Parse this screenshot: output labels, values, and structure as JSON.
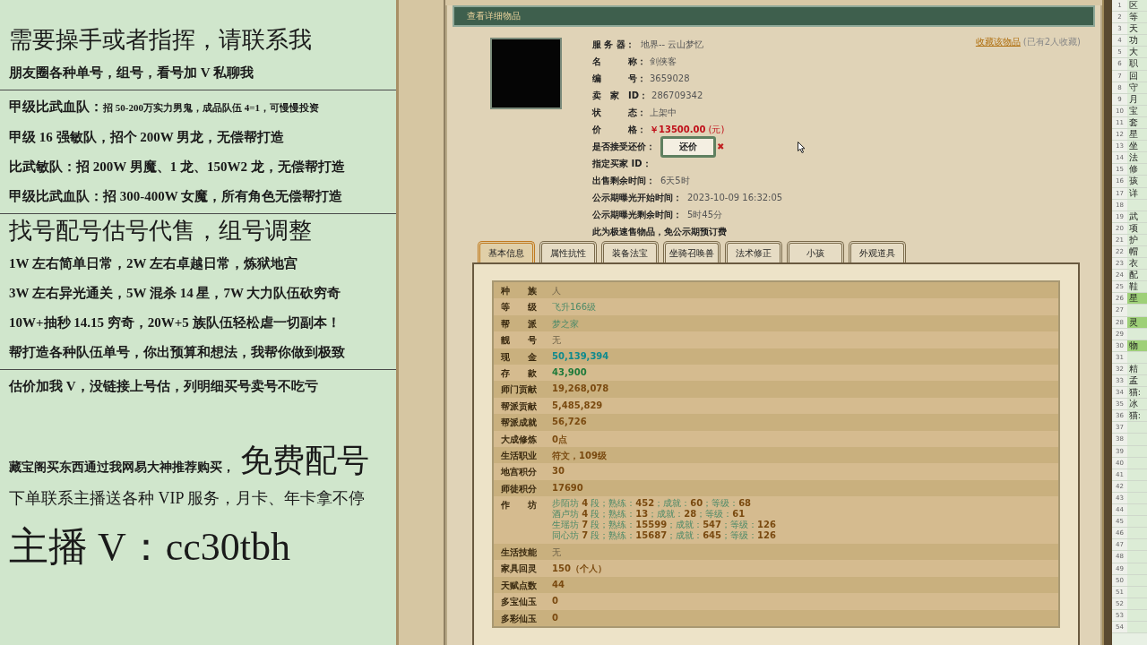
{
  "promo_panel": {
    "items": [
      {
        "kind": "heading",
        "text": "需要操手或者指挥，请联系我"
      },
      {
        "kind": "text",
        "text": "朋友圈各种单号，组号，看号加 V 私聊我"
      },
      {
        "kind": "rule"
      },
      {
        "kind": "split",
        "lead": "甲级比武血队：",
        "rest": "招 50-200万实力男鬼，成品队伍 4=1，可慢慢投资"
      },
      {
        "kind": "text",
        "text": "甲级 16 强敏队，招个 200W 男龙，无偿帮打造"
      },
      {
        "kind": "text",
        "text": "比武敏队：招 200W 男魔、1 龙、150W2 龙，无偿帮打造"
      },
      {
        "kind": "text",
        "text": "甲级比武血队：招 300-400W 女魔，所有角色无偿帮打造"
      },
      {
        "kind": "rule"
      },
      {
        "kind": "heading",
        "text": "找号配号估号代售，组号调整"
      },
      {
        "kind": "text",
        "text": "1W 左右简单日常，2W 左右卓越日常，炼狱地宫"
      },
      {
        "kind": "text",
        "text": "3W 左右异光通关，5W 混杀 14 星，7W 大力队伍砍穷奇"
      },
      {
        "kind": "text",
        "text": "10W+抽秒 14.15 穷奇，20W+5 族队伍轻松虐一切副本！"
      },
      {
        "kind": "text",
        "text": "帮打造各种队伍单号，你出预算和想法，我帮你做到极致"
      },
      {
        "kind": "rule"
      },
      {
        "kind": "text",
        "text": "估价加我 V，没链接上号估，列明细买号卖号不吃亏"
      },
      {
        "kind": "pair",
        "lead": "藏宝阁买东西通过我网易大神推荐购买，",
        "rest": "免费配号"
      },
      {
        "kind": "wide",
        "text": "下单联系主播送各种 VIP 服务，月卡、年卡拿不停"
      },
      {
        "kind": "contact",
        "text": "主播 V：cc30tbh"
      }
    ]
  },
  "detail_window": {
    "title": "查看详细物品",
    "favorite": {
      "link": "收藏该物品",
      "note": "(已有2人收藏)"
    },
    "info": [
      {
        "kind": "field",
        "label": "服 务 器：",
        "value": "地界-- 云山梦忆"
      },
      {
        "kind": "field",
        "label": "名　　　称：",
        "value": "剑侠客"
      },
      {
        "kind": "field",
        "label": "编　　　号：",
        "value": "3659028"
      },
      {
        "kind": "field",
        "label": "卖　家　ID：",
        "value": "286709342"
      },
      {
        "kind": "field",
        "label": "状　　　态：",
        "value": "上架中"
      },
      {
        "kind": "price",
        "label": "价　　　格：",
        "value": "￥13500.00",
        "unit": "(元)"
      },
      {
        "kind": "button",
        "label": "是否接受还价：",
        "value": "还价",
        "mark": "✖"
      },
      {
        "kind": "wide",
        "label": "指定买家 ID："
      },
      {
        "kind": "wide",
        "label": "出售剩余时间：",
        "value": "6天5时"
      },
      {
        "kind": "wide",
        "label": "公示期曝光开始时间：",
        "value": "2023-10-09 16:32:05"
      },
      {
        "kind": "wide",
        "label": "公示期曝光剩余时间：",
        "value": "5时45分"
      },
      {
        "kind": "note",
        "label": "此为极速售物品，免公示期预订费"
      }
    ],
    "tabs": [
      {
        "label": "基本信息",
        "selected": true
      },
      {
        "label": "属性抗性",
        "selected": false
      },
      {
        "label": "装备法宝",
        "selected": false
      },
      {
        "label": "坐骑召唤兽",
        "selected": false
      },
      {
        "label": "法术修正",
        "selected": false
      },
      {
        "label": "小孩",
        "selected": false
      },
      {
        "label": "外观道具",
        "selected": false
      }
    ],
    "table": {
      "rows": [
        {
          "label": "种　　族",
          "value": "人",
          "kind": "plain"
        },
        {
          "label": "等　　级",
          "value": "飞升166级",
          "kind": "green"
        },
        {
          "label": "帮　　派",
          "value": "梦之家",
          "kind": "green"
        },
        {
          "label": "靓　　号",
          "value": "无",
          "kind": "plain"
        },
        {
          "label": "现　　金",
          "value": "50,139,394",
          "kind": "cyan"
        },
        {
          "label": "存　　款",
          "value": "43,900",
          "kind": "lime"
        },
        {
          "label": "师门贡献",
          "value": "19,268,078",
          "kind": "number"
        },
        {
          "label": "帮派贡献",
          "value": "5,485,829",
          "kind": "number"
        },
        {
          "label": "帮派成就",
          "value": "56,726",
          "kind": "number"
        },
        {
          "label": "大成修炼",
          "value": "0点",
          "kind": "number"
        },
        {
          "label": "生活职业",
          "value": "符文，109级",
          "kind": "number"
        },
        {
          "label": "地宫积分",
          "value": "30",
          "kind": "number"
        },
        {
          "label": "师徒积分",
          "value": "17690",
          "kind": "number"
        },
        {
          "label": "作　　坊",
          "kind": "workshop",
          "lines": [
            [
              {
                "text": "步陌坊 ",
                "kind": "label"
              },
              {
                "text": "4",
                "kind": "number"
              },
              {
                "text": " 段；熟练：",
                "kind": "label"
              },
              {
                "text": "452",
                "kind": "number"
              },
              {
                "text": "；成就：",
                "kind": "label"
              },
              {
                "text": "60",
                "kind": "number"
              },
              {
                "text": "；等级：",
                "kind": "label"
              },
              {
                "text": "68",
                "kind": "number"
              }
            ],
            [
              {
                "text": "酒卢坊 ",
                "kind": "label"
              },
              {
                "text": "4",
                "kind": "number"
              },
              {
                "text": " 段；熟练：",
                "kind": "label"
              },
              {
                "text": "13",
                "kind": "number"
              },
              {
                "text": "；成就：",
                "kind": "label"
              },
              {
                "text": "28",
                "kind": "number"
              },
              {
                "text": "；等级：",
                "kind": "label"
              },
              {
                "text": "61",
                "kind": "number"
              }
            ],
            [
              {
                "text": "生瑶坊 ",
                "kind": "label"
              },
              {
                "text": "7",
                "kind": "number"
              },
              {
                "text": " 段；熟练：",
                "kind": "label"
              },
              {
                "text": "15599",
                "kind": "number"
              },
              {
                "text": "；成就：",
                "kind": "label"
              },
              {
                "text": "547",
                "kind": "number"
              },
              {
                "text": "；等级：",
                "kind": "label"
              },
              {
                "text": "126",
                "kind": "number"
              }
            ],
            [
              {
                "text": "同心坊 ",
                "kind": "label"
              },
              {
                "text": "7",
                "kind": "number"
              },
              {
                "text": " 段；熟练：",
                "kind": "label"
              },
              {
                "text": "15687",
                "kind": "number"
              },
              {
                "text": "；成就：",
                "kind": "label"
              },
              {
                "text": "645",
                "kind": "number"
              },
              {
                "text": "；等级：",
                "kind": "label"
              },
              {
                "text": "126",
                "kind": "number"
              }
            ]
          ]
        },
        {
          "label": "生活技能",
          "value": "无",
          "kind": "plain"
        },
        {
          "label": "家具回灵",
          "value": "150（个人）",
          "kind": "number"
        },
        {
          "label": "天赋点数",
          "value": "44",
          "kind": "number"
        },
        {
          "label": "多宝仙玉",
          "value": "0",
          "kind": "number"
        },
        {
          "label": "多彩仙玉",
          "value": "0",
          "kind": "number"
        }
      ]
    }
  },
  "spreadsheet": {
    "rows": [
      {
        "number": "1",
        "text": "区",
        "highlighted": false
      },
      {
        "number": "2",
        "text": "等",
        "highlighted": false
      },
      {
        "number": "3",
        "text": "天",
        "highlighted": false
      },
      {
        "number": "4",
        "text": "功",
        "highlighted": false
      },
      {
        "number": "5",
        "text": "大",
        "highlighted": false
      },
      {
        "number": "6",
        "text": "职",
        "highlighted": false
      },
      {
        "number": "7",
        "text": "回",
        "highlighted": false
      },
      {
        "number": "8",
        "text": "守",
        "highlighted": false
      },
      {
        "number": "9",
        "text": "月",
        "highlighted": false
      },
      {
        "number": "10",
        "text": "宝",
        "highlighted": false
      },
      {
        "number": "11",
        "text": "套",
        "highlighted": false
      },
      {
        "number": "12",
        "text": "星",
        "highlighted": false
      },
      {
        "number": "13",
        "text": "坐",
        "highlighted": false
      },
      {
        "number": "14",
        "text": "法",
        "highlighted": false
      },
      {
        "number": "15",
        "text": "修",
        "highlighted": false
      },
      {
        "number": "16",
        "text": "孩",
        "highlighted": false
      },
      {
        "number": "17",
        "text": "详",
        "highlighted": false
      },
      {
        "number": "18",
        "highlighted": false
      },
      {
        "number": "19",
        "text": "武",
        "highlighted": false
      },
      {
        "number": "20",
        "text": "项",
        "highlighted": false
      },
      {
        "number": "21",
        "text": "护",
        "highlighted": false
      },
      {
        "number": "22",
        "text": "帽",
        "highlighted": false
      },
      {
        "number": "23",
        "text": "衣",
        "highlighted": false
      },
      {
        "number": "24",
        "text": "配",
        "highlighted": false
      },
      {
        "number": "25",
        "text": "鞋",
        "highlighted": false
      },
      {
        "number": "26",
        "text": "星",
        "highlighted": true
      },
      {
        "number": "27",
        "highlighted": false
      },
      {
        "number": "28",
        "text": "灵",
        "highlighted": true
      },
      {
        "number": "29",
        "highlighted": false
      },
      {
        "number": "30",
        "text": "物",
        "highlighted": true
      },
      {
        "number": "31",
        "highlighted": false
      },
      {
        "number": "32",
        "text": "精",
        "highlighted": false
      },
      {
        "number": "33",
        "text": "孟",
        "highlighted": false
      },
      {
        "number": "34",
        "text": "猫:",
        "highlighted": false
      },
      {
        "number": "35",
        "text": "冰",
        "highlighted": false
      },
      {
        "number": "36",
        "text": "猫:",
        "highlighted": false
      },
      {
        "number": "37",
        "highlighted": false
      },
      {
        "number": "38",
        "highlighted": false
      },
      {
        "number": "39",
        "highlighted": false
      },
      {
        "number": "40",
        "highlighted": false
      },
      {
        "number": "41",
        "highlighted": false
      },
      {
        "number": "42",
        "highlighted": false
      },
      {
        "number": "43",
        "highlighted": false
      },
      {
        "number": "44",
        "highlighted": false
      },
      {
        "number": "45",
        "highlighted": false
      },
      {
        "number": "46",
        "highlighted": false
      },
      {
        "number": "47",
        "highlighted": false
      },
      {
        "number": "48",
        "highlighted": false
      },
      {
        "number": "49",
        "highlighted": false
      },
      {
        "number": "50",
        "highlighted": false
      },
      {
        "number": "51",
        "highlighted": false
      },
      {
        "number": "52",
        "highlighted": false
      },
      {
        "number": "53",
        "highlighted": false
      },
      {
        "number": "54",
        "highlighted": false
      }
    ]
  }
}
